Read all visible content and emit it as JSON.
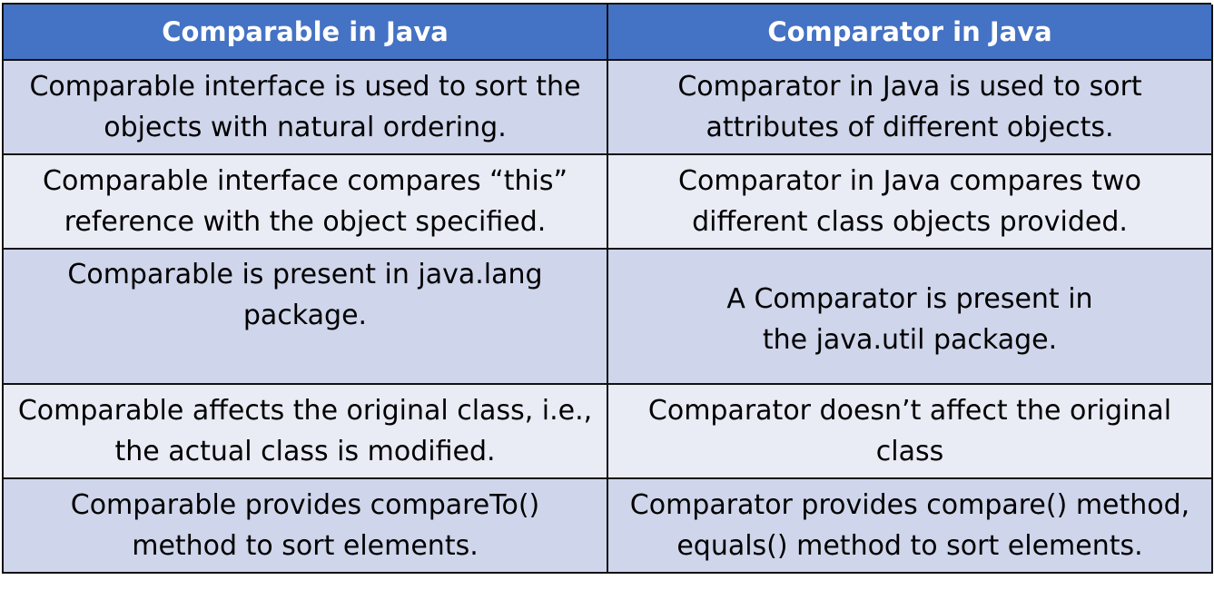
{
  "table": {
    "headers": [
      "Comparable in Java",
      "Comparator in Java"
    ],
    "rows": [
      [
        "Comparable interface is used to sort the\nobjects with natural ordering.",
        "Comparator in Java is used to sort\nattributes of different objects."
      ],
      [
        "Comparable interface compares “this”\nreference with the object specified.",
        "Comparator in Java compares two\ndifferent class objects provided."
      ],
      [
        "Comparable is present in java.lang\npackage.",
        "A Comparator is present in\nthe java.util package."
      ],
      [
        "Comparable affects the original class, i.e.,\nthe actual class is modified.",
        "Comparator doesn’t affect the original\nclass"
      ],
      [
        "Comparable provides compareTo()\nmethod to sort elements.",
        "Comparator provides compare() method,\nequals() method to sort elements."
      ]
    ]
  },
  "colors": {
    "header_bg": "#4472c4",
    "row_dark": "#cfd5ea",
    "row_light": "#e9ebf5",
    "border": "#111111"
  }
}
